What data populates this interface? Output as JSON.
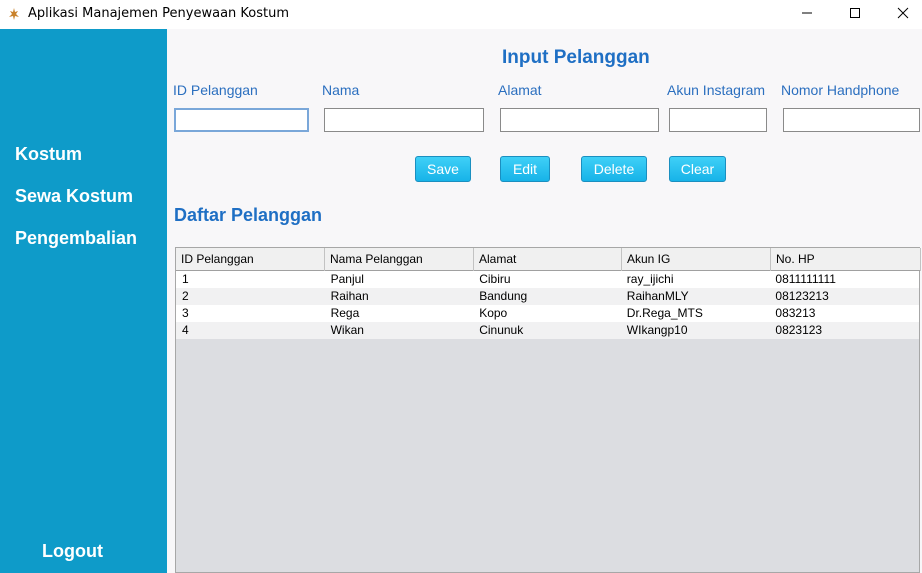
{
  "window": {
    "title": "Aplikasi Manajemen Penyewaan Kostum",
    "icon": "app-logo-icon"
  },
  "sidebar": {
    "background": "#0e9bc9",
    "items": [
      {
        "label": "Kostum"
      },
      {
        "label": "Sewa Kostum"
      },
      {
        "label": "Pengembalian"
      }
    ],
    "logout_label": "Logout"
  },
  "form": {
    "title": "Input Pelanggan",
    "fields": [
      {
        "label": "ID Pelanggan",
        "value": "",
        "placeholder": ""
      },
      {
        "label": "Nama",
        "value": "",
        "placeholder": ""
      },
      {
        "label": "Alamat",
        "value": "",
        "placeholder": ""
      },
      {
        "label": "Akun Instagram",
        "value": "",
        "placeholder": ""
      },
      {
        "label": "Nomor Handphone",
        "value": "",
        "placeholder": ""
      }
    ],
    "buttons": {
      "save": "Save",
      "edit": "Edit",
      "delete": "Delete",
      "clear": "Clear"
    },
    "accent": "#1f6fc4"
  },
  "table": {
    "title": "Daftar Pelanggan",
    "columns": [
      "ID Pelanggan",
      "Nama Pelanggan",
      "Alamat",
      "Akun IG",
      "No. HP"
    ],
    "rows": [
      [
        "1",
        "Panjul",
        "Cibiru",
        "ray_ijichi",
        "0811111111"
      ],
      [
        "2",
        "Raihan",
        "Bandung",
        "RaihanMLY",
        "08123213"
      ],
      [
        "3",
        "Rega",
        "Kopo",
        "Dr.Rega_MTS",
        "083213"
      ],
      [
        "4",
        "Wikan",
        "Cinunuk",
        "WIkangp10",
        "0823123"
      ]
    ]
  }
}
